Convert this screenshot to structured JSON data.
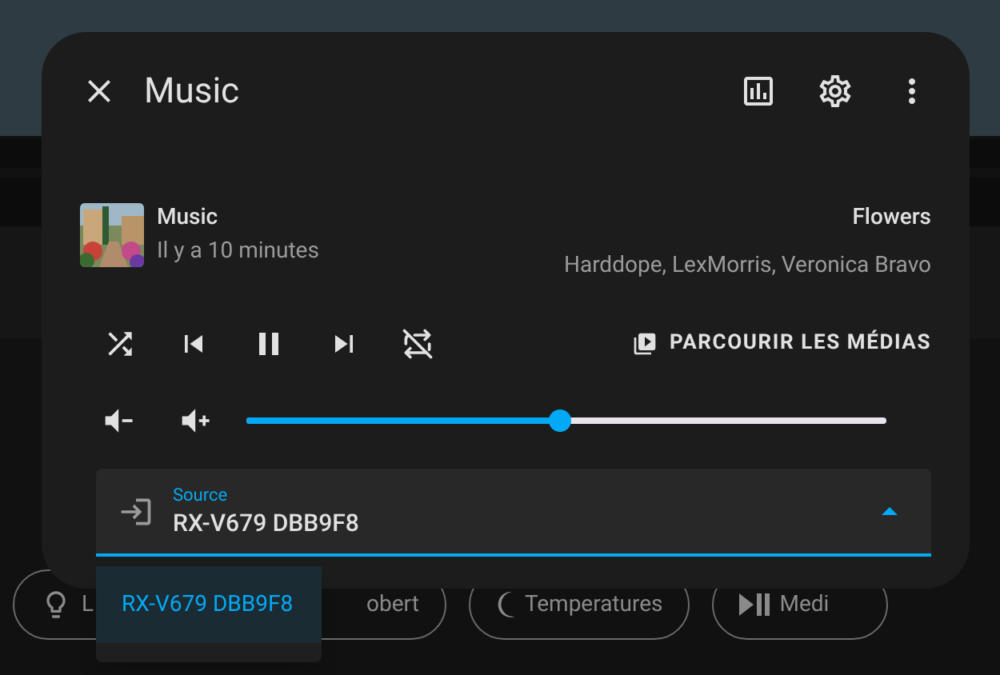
{
  "dialog": {
    "title": "Music"
  },
  "media": {
    "app": "Music",
    "time": "Il y a 10 minutes",
    "track": "Flowers",
    "artist": "Harddope, LexMorris, Veronica Bravo",
    "playing": true
  },
  "controls": {
    "browse_label": "PARCOURIR LES MÉDIAS"
  },
  "volume": {
    "level": 0.49
  },
  "source": {
    "label": "Source",
    "value": "RX-V679 DBB9F8",
    "expanded": true
  },
  "source_options": [
    {
      "label": "RX-V679 DBB9F8",
      "selected": true
    }
  ],
  "background_chips": [
    {
      "kind": "bulb",
      "label": "L"
    },
    {
      "kind": "none",
      "label": "obert"
    },
    {
      "kind": "moon",
      "label": "Temperatures"
    },
    {
      "kind": "media",
      "label": "Medi"
    }
  ]
}
